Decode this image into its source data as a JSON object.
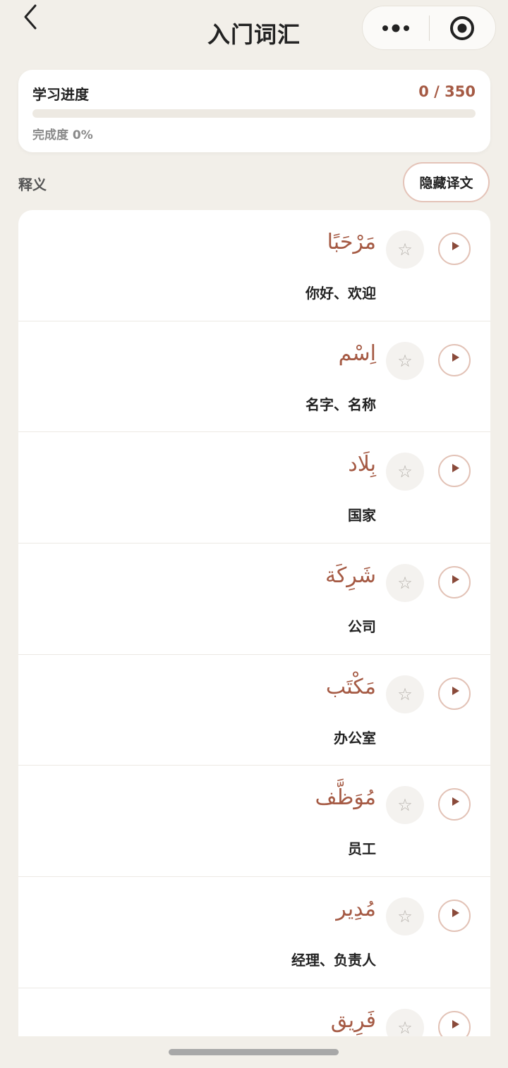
{
  "header": {
    "title": "入门词汇"
  },
  "progress": {
    "title": "学习进度",
    "count": "0 / 350",
    "percent_label": "完成度 0%",
    "fraction": 0
  },
  "section": {
    "label": "释义",
    "toggle_label": "隐藏译文"
  },
  "words": [
    {
      "arabic": "مَرْحَبًا",
      "meaning": "你好、欢迎"
    },
    {
      "arabic": "اِسْم",
      "meaning": "名字、名称"
    },
    {
      "arabic": "بِلَاد",
      "meaning": "国家"
    },
    {
      "arabic": "شَرِكَة",
      "meaning": "公司"
    },
    {
      "arabic": "مَكْتَب",
      "meaning": "办公室"
    },
    {
      "arabic": "مُوَظَّف",
      "meaning": "员工"
    },
    {
      "arabic": "مُدِير",
      "meaning": "经理、负责人"
    },
    {
      "arabic": "فَرِيق",
      "meaning": ""
    }
  ],
  "icons": {
    "star": "☆"
  },
  "colors": {
    "accent": "#a55a44",
    "background": "#f2efe9"
  }
}
